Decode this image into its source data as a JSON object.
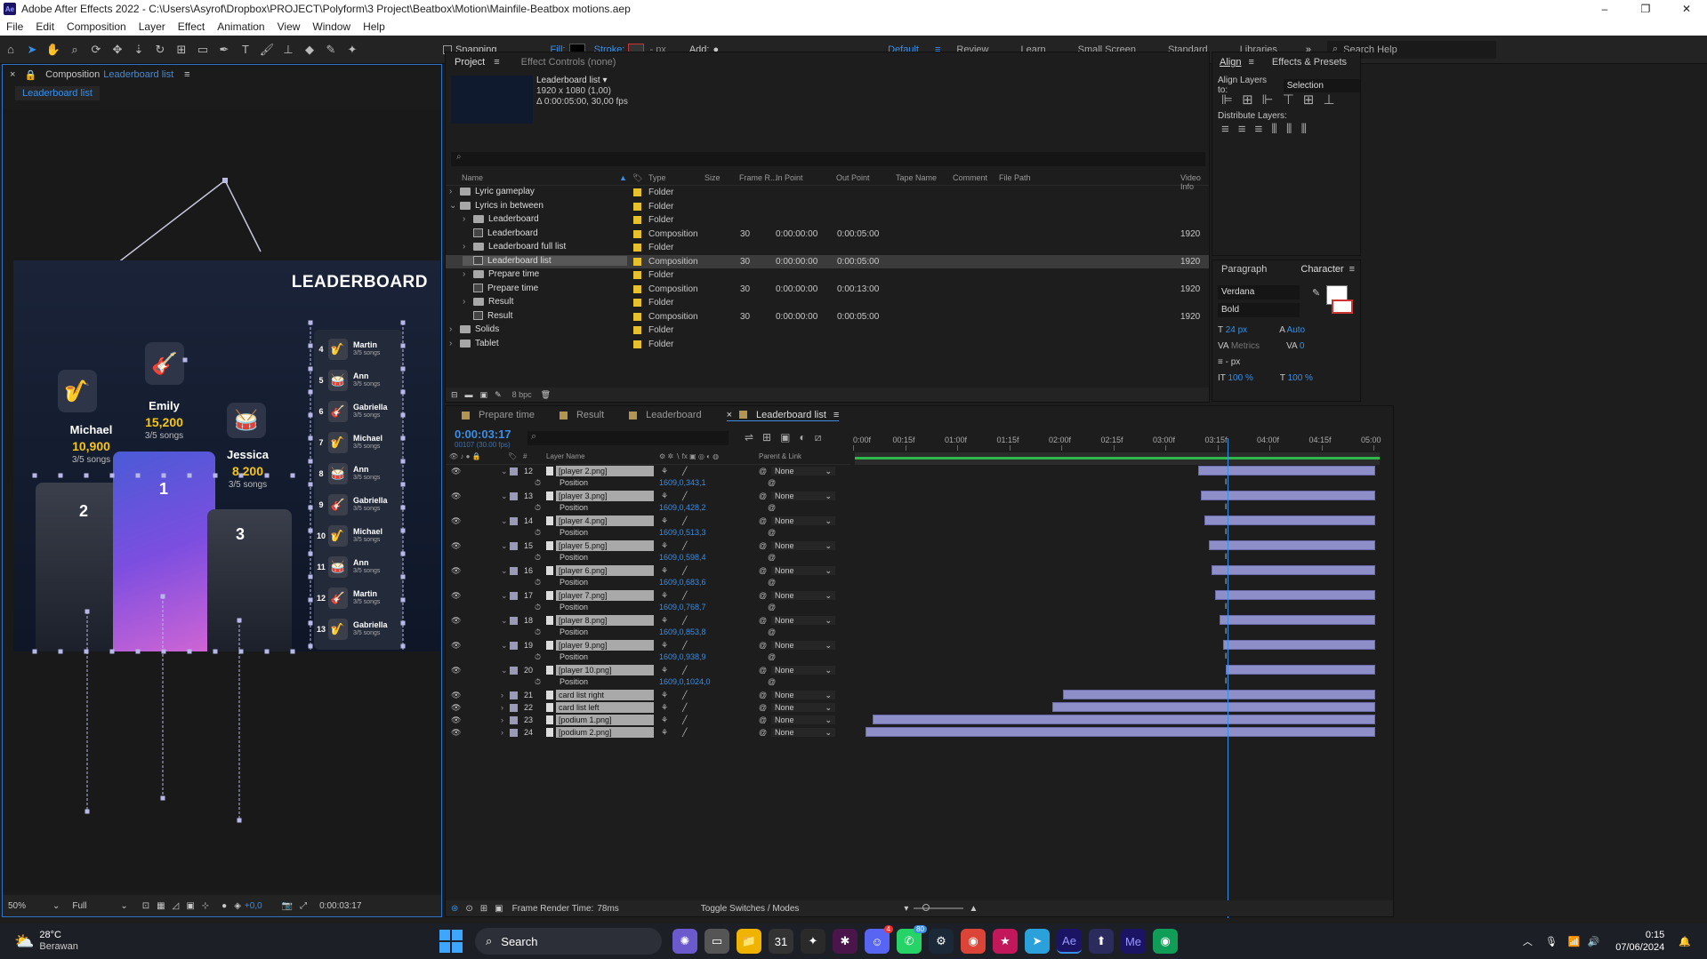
{
  "window": {
    "title": "Adobe After Effects 2022 - C:\\Users\\Asyrof\\Dropbox\\PROJECT\\Polyform\\3 Project\\Beatbox\\Motion\\Mainfile-Beatbox motions.aep",
    "app_icon": "Ae",
    "controls": [
      "–",
      "❐",
      "✕"
    ]
  },
  "menu": [
    "File",
    "Edit",
    "Composition",
    "Layer",
    "Effect",
    "Animation",
    "View",
    "Window",
    "Help"
  ],
  "toolbar": {
    "snapping_label": "Snapping",
    "fill_label": "Fill:",
    "stroke_label": "Stroke:",
    "px_label": "- px",
    "add_label": "Add:",
    "workspaces": [
      "Default",
      "Review",
      "Learn",
      "Small Screen",
      "Standard",
      "Libraries"
    ],
    "active_workspace": "Default",
    "search_help": "Search Help"
  },
  "composition_panel": {
    "tab_prefix": "Composition",
    "tab_name": "Leaderboard list",
    "breadcrumb": "Leaderboard list",
    "zoom": "50%",
    "resolution": "Full",
    "exposure": "+0,0",
    "timecode": "0:00:03:17",
    "canvas": {
      "heading": "LEADERBOARD",
      "podium": [
        {
          "rank": "2",
          "name": "Michael",
          "score": "10,900",
          "songs": "3/5 songs"
        },
        {
          "rank": "1",
          "name": "Emily",
          "score": "15,200",
          "songs": "3/5 songs"
        },
        {
          "rank": "3",
          "name": "Jessica",
          "score": "8,200",
          "songs": "3/5 songs"
        }
      ],
      "list": [
        {
          "rank": "4",
          "name": "Martin",
          "songs": "3/5 songs"
        },
        {
          "rank": "5",
          "name": "Ann",
          "songs": "3/5 songs"
        },
        {
          "rank": "6",
          "name": "Gabriella",
          "songs": "3/5 songs"
        },
        {
          "rank": "7",
          "name": "Michael",
          "songs": "3/5 songs"
        },
        {
          "rank": "8",
          "name": "Ann",
          "songs": "3/5 songs"
        },
        {
          "rank": "9",
          "name": "Gabriella",
          "songs": "3/5 songs"
        },
        {
          "rank": "10",
          "name": "Michael",
          "songs": "3/5 songs"
        },
        {
          "rank": "11",
          "name": "Ann",
          "songs": "3/5 songs"
        },
        {
          "rank": "12",
          "name": "Martin",
          "songs": "3/5 songs"
        },
        {
          "rank": "13",
          "name": "Gabriella",
          "songs": "3/5 songs"
        }
      ]
    }
  },
  "project_panel": {
    "tab": "Project",
    "tab2": "Effect Controls (none)",
    "preview_name": "Leaderboard list ▾",
    "preview_info1": "1920 x 1080 (1,00)",
    "preview_info2": "Δ 0:00:05:00, 30,00 fps",
    "bpc": "8 bpc",
    "columns": [
      "Name",
      "Type",
      "Size",
      "Frame R...",
      "In Point",
      "Out Point",
      "Tape Name",
      "Comment",
      "File Path",
      "Video Info"
    ],
    "items": [
      {
        "name": "Lyric gameplay",
        "type": "Folder",
        "fps": "",
        "in": "",
        "out": "",
        "res": "",
        "indent": 0,
        "kind": "folder",
        "arrow": "›"
      },
      {
        "name": "Lyrics in between",
        "type": "Folder",
        "fps": "",
        "in": "",
        "out": "",
        "res": "",
        "indent": 0,
        "kind": "folder",
        "arrow": "⌄"
      },
      {
        "name": "Leaderboard",
        "type": "Folder",
        "fps": "",
        "in": "",
        "out": "",
        "res": "",
        "indent": 1,
        "kind": "folder",
        "arrow": "›"
      },
      {
        "name": "Leaderboard",
        "type": "Composition",
        "fps": "30",
        "in": "0:00:00:00",
        "out": "0:00:05:00",
        "res": "1920",
        "indent": 1,
        "kind": "comp",
        "arrow": ""
      },
      {
        "name": "Leaderboard full list",
        "type": "Folder",
        "fps": "",
        "in": "",
        "out": "",
        "res": "",
        "indent": 1,
        "kind": "folder",
        "arrow": "›"
      },
      {
        "name": "Leaderboard list",
        "type": "Composition",
        "fps": "30",
        "in": "0:00:00:00",
        "out": "0:00:05:00",
        "res": "1920",
        "indent": 1,
        "kind": "comp",
        "arrow": "",
        "selected": true
      },
      {
        "name": "Prepare time",
        "type": "Folder",
        "fps": "",
        "in": "",
        "out": "",
        "res": "",
        "indent": 1,
        "kind": "folder",
        "arrow": "›"
      },
      {
        "name": "Prepare time",
        "type": "Composition",
        "fps": "30",
        "in": "0:00:00:00",
        "out": "0:00:13:00",
        "res": "1920",
        "indent": 1,
        "kind": "comp",
        "arrow": ""
      },
      {
        "name": "Result",
        "type": "Folder",
        "fps": "",
        "in": "",
        "out": "",
        "res": "",
        "indent": 1,
        "kind": "folder",
        "arrow": "›"
      },
      {
        "name": "Result",
        "type": "Composition",
        "fps": "30",
        "in": "0:00:00:00",
        "out": "0:00:05:00",
        "res": "1920",
        "indent": 1,
        "kind": "comp",
        "arrow": ""
      },
      {
        "name": "Solids",
        "type": "Folder",
        "fps": "",
        "in": "",
        "out": "",
        "res": "",
        "indent": 0,
        "kind": "folder",
        "arrow": "›"
      },
      {
        "name": "Tablet",
        "type": "Folder",
        "fps": "",
        "in": "",
        "out": "",
        "res": "",
        "indent": 0,
        "kind": "folder",
        "arrow": "›"
      }
    ]
  },
  "align_panel": {
    "tab": "Align",
    "tab2": "Effects & Presets",
    "align_to_label": "Align Layers to:",
    "align_to_value": "Selection",
    "distribute_label": "Distribute Layers:"
  },
  "character_panel": {
    "tab1": "Paragraph",
    "tab2": "Character",
    "font": "Verdana",
    "style": "Bold",
    "size": "24 px",
    "leading": "Auto",
    "kerning": "Metrics",
    "tracking": "0",
    "stroke_px": "- px",
    "vscale": "100 %",
    "hscale": "100 %"
  },
  "timeline": {
    "tabs": [
      "Prepare time",
      "Result",
      "Leaderboard",
      "Leaderboard list"
    ],
    "active_tab": "Leaderboard list",
    "timecode": "0:00:03:17",
    "timecode_sub": "00107 (30.00 fps)",
    "col_layer_name": "Layer Name",
    "col_parent": "Parent & Link",
    "ruler": [
      "0:00f",
      "00:15f",
      "01:00f",
      "01:15f",
      "02:00f",
      "02:15f",
      "03:00f",
      "03:15f",
      "04:00f",
      "04:15f",
      "05:00"
    ],
    "footer_render": "Frame Render Time:",
    "footer_render_val": "78ms",
    "footer_toggle": "Toggle Switches / Modes",
    "layers": [
      {
        "num": "12",
        "name": "[player 2.png]",
        "pos": "1609,0,343,1",
        "parent": "None",
        "expanded": true,
        "bar_start": 0.66
      },
      {
        "num": "13",
        "name": "[player 3.png]",
        "pos": "1609,0,428,2",
        "parent": "None",
        "expanded": true,
        "bar_start": 0.665
      },
      {
        "num": "14",
        "name": "[player 4.png]",
        "pos": "1609,0,513,3",
        "parent": "None",
        "expanded": true,
        "bar_start": 0.672
      },
      {
        "num": "15",
        "name": "[player 5.png]",
        "pos": "1609,0,598,4",
        "parent": "None",
        "expanded": true,
        "bar_start": 0.68
      },
      {
        "num": "16",
        "name": "[player 6.png]",
        "pos": "1609,0,683,6",
        "parent": "None",
        "expanded": true,
        "bar_start": 0.686
      },
      {
        "num": "17",
        "name": "[player 7.png]",
        "pos": "1609,0,768,7",
        "parent": "None",
        "expanded": true,
        "bar_start": 0.693
      },
      {
        "num": "18",
        "name": "[player 8.png]",
        "pos": "1609,0,853,8",
        "parent": "None",
        "expanded": true,
        "bar_start": 0.7
      },
      {
        "num": "19",
        "name": "[player 9.png]",
        "pos": "1609,0,938,9",
        "parent": "None",
        "expanded": true,
        "bar_start": 0.707
      },
      {
        "num": "20",
        "name": "[player 10.png]",
        "pos": "1609,0,1024,0",
        "parent": "None",
        "expanded": true,
        "bar_start": 0.713
      },
      {
        "num": "21",
        "name": "card list right",
        "pos": "",
        "parent": "None",
        "expanded": false,
        "bar_start": 0.4
      },
      {
        "num": "22",
        "name": "card list left",
        "pos": "",
        "parent": "None",
        "expanded": false,
        "bar_start": 0.38
      },
      {
        "num": "23",
        "name": "[podium 1.png]",
        "pos": "",
        "parent": "None",
        "expanded": false,
        "bar_start": 0.035
      },
      {
        "num": "24",
        "name": "[podium 2.png]",
        "pos": "",
        "parent": "None",
        "expanded": false,
        "bar_start": 0.02
      }
    ],
    "position_label": "Position",
    "playhead_fraction": 0.716
  },
  "taskbar": {
    "weather_temp": "28°C",
    "weather_desc": "Berawan",
    "search_label": "Search",
    "time": "0:15",
    "date": "07/06/2024",
    "badges": {
      "discord": "4",
      "whatsapp": "80"
    }
  },
  "colors": {
    "accent": "#3a8ee6",
    "folder_label": "#e6c12a",
    "layer_bar": "#8e8ec8",
    "canvas_bg": "#0f1a2e"
  }
}
